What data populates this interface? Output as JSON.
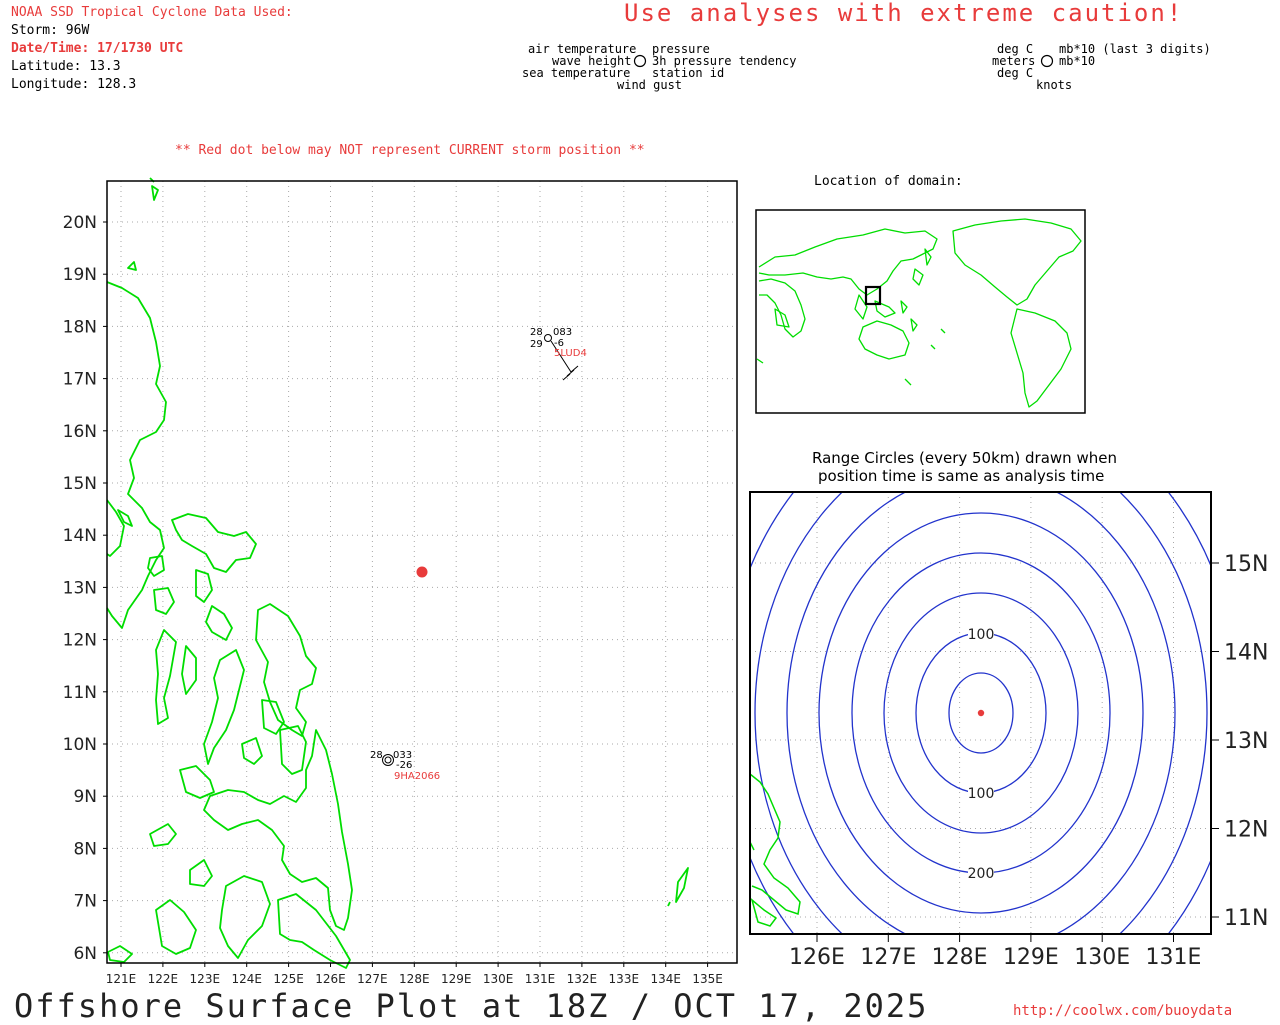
{
  "header": {
    "title": "NOAA SSD Tropical Cyclone Data Used:",
    "storm": "Storm: 96W",
    "datetime": "Date/Time: 17/1730 UTC",
    "latitude": "Latitude: 13.3",
    "longitude": "Longitude: 128.3"
  },
  "caution": "Use analyses with extreme caution!",
  "legend_left": {
    "air_temp": "air temperature",
    "pressure": "pressure",
    "wave_height": "wave height",
    "tendency": "3h pressure tendency",
    "sea_temp": "sea temperature",
    "station_id": "station id",
    "wind_gust": "wind gust"
  },
  "legend_right": {
    "deg_c_1": "deg C",
    "mb_last3": "mb*10 (last 3 digits)",
    "meters": "meters",
    "mb10": "mb*10",
    "deg_c_2": "deg C",
    "knots": "knots"
  },
  "red_dot_note": "** Red dot below may NOT represent CURRENT storm position **",
  "main_map": {
    "lat_labels": [
      "20N",
      "19N",
      "18N",
      "17N",
      "16N",
      "15N",
      "14N",
      "13N",
      "12N",
      "11N",
      "10N",
      "9N",
      "8N",
      "7N",
      "6N"
    ],
    "lon_labels": [
      "121E",
      "122E",
      "123E",
      "124E",
      "125E",
      "126E",
      "127E",
      "128E",
      "129E",
      "130E",
      "131E",
      "132E",
      "133E",
      "134E",
      "135E"
    ],
    "stations": [
      {
        "id": "5LUD4",
        "air_temp": "28",
        "sea_temp": "29",
        "pressure": "083",
        "tendency": "-6"
      },
      {
        "id": "9HA2066",
        "air_temp": "28",
        "pressure": "033",
        "tendency": "-26"
      }
    ]
  },
  "location_title": "Location of domain:",
  "range": {
    "title_line1": "Range Circles (every 50km) drawn when",
    "title_line2": "position time is same as analysis time",
    "lat_labels": [
      "15N",
      "14N",
      "13N",
      "12N",
      "11N"
    ],
    "lon_labels": [
      "126E",
      "127E",
      "128E",
      "129E",
      "130E",
      "131E"
    ],
    "circle_labels": [
      "100",
      "100",
      "200"
    ]
  },
  "footer": {
    "title": "Offshore Surface Plot at 18Z / OCT 17, 2025",
    "url": "http://coolwx.com/buoydata"
  },
  "colors": {
    "coast": "#00dd00",
    "storm": "#e83b3b",
    "rings": "#2233cc",
    "label_red": "#e83b3b"
  }
}
